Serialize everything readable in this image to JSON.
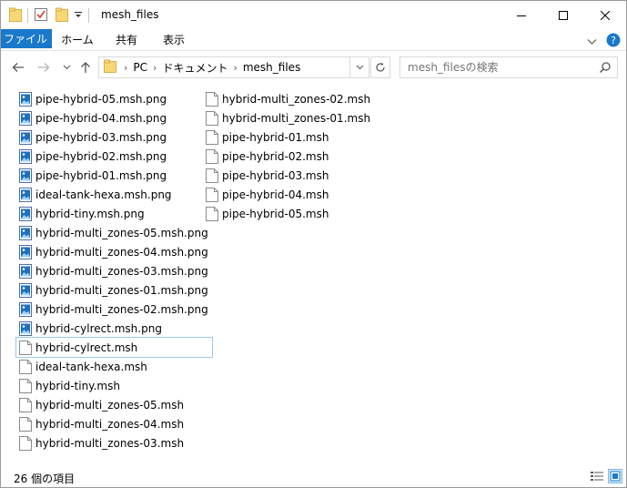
{
  "window": {
    "title": "mesh_files"
  },
  "ribbon": {
    "tabs": [
      "ファイル",
      "ホーム",
      "共有",
      "表示"
    ]
  },
  "address": {
    "crumbs": [
      "PC",
      "ドキュメント",
      "mesh_files"
    ]
  },
  "search": {
    "placeholder": "mesh_filesの検索"
  },
  "files": {
    "column1": [
      {
        "name": "pipe-hybrid-05.msh.png",
        "type": "image"
      },
      {
        "name": "pipe-hybrid-04.msh.png",
        "type": "image"
      },
      {
        "name": "pipe-hybrid-03.msh.png",
        "type": "image"
      },
      {
        "name": "pipe-hybrid-02.msh.png",
        "type": "image"
      },
      {
        "name": "pipe-hybrid-01.msh.png",
        "type": "image"
      },
      {
        "name": "ideal-tank-hexa.msh.png",
        "type": "image"
      },
      {
        "name": "hybrid-tiny.msh.png",
        "type": "image"
      },
      {
        "name": "hybrid-multi_zones-05.msh.png",
        "type": "image"
      },
      {
        "name": "hybrid-multi_zones-04.msh.png",
        "type": "image"
      },
      {
        "name": "hybrid-multi_zones-03.msh.png",
        "type": "image"
      },
      {
        "name": "hybrid-multi_zones-01.msh.png",
        "type": "image"
      },
      {
        "name": "hybrid-multi_zones-02.msh.png",
        "type": "image"
      },
      {
        "name": "hybrid-cylrect.msh.png",
        "type": "image"
      },
      {
        "name": "hybrid-cylrect.msh",
        "type": "file",
        "selected": true
      },
      {
        "name": "ideal-tank-hexa.msh",
        "type": "file"
      },
      {
        "name": "hybrid-tiny.msh",
        "type": "file"
      },
      {
        "name": "hybrid-multi_zones-05.msh",
        "type": "file"
      },
      {
        "name": "hybrid-multi_zones-04.msh",
        "type": "file"
      },
      {
        "name": "hybrid-multi_zones-03.msh",
        "type": "file"
      }
    ],
    "column2": [
      {
        "name": "hybrid-multi_zones-02.msh",
        "type": "file"
      },
      {
        "name": "hybrid-multi_zones-01.msh",
        "type": "file"
      },
      {
        "name": "pipe-hybrid-01.msh",
        "type": "file"
      },
      {
        "name": "pipe-hybrid-02.msh",
        "type": "file"
      },
      {
        "name": "pipe-hybrid-03.msh",
        "type": "file"
      },
      {
        "name": "pipe-hybrid-04.msh",
        "type": "file"
      },
      {
        "name": "pipe-hybrid-05.msh",
        "type": "file"
      }
    ]
  },
  "status": {
    "count_text": "26 個の項目"
  },
  "colors": {
    "accent": "#1979ca",
    "folder": "#f8d775",
    "selection_border": "#99c8f1"
  },
  "icons": {
    "image": "image-file-icon",
    "file": "blank-file-icon"
  }
}
